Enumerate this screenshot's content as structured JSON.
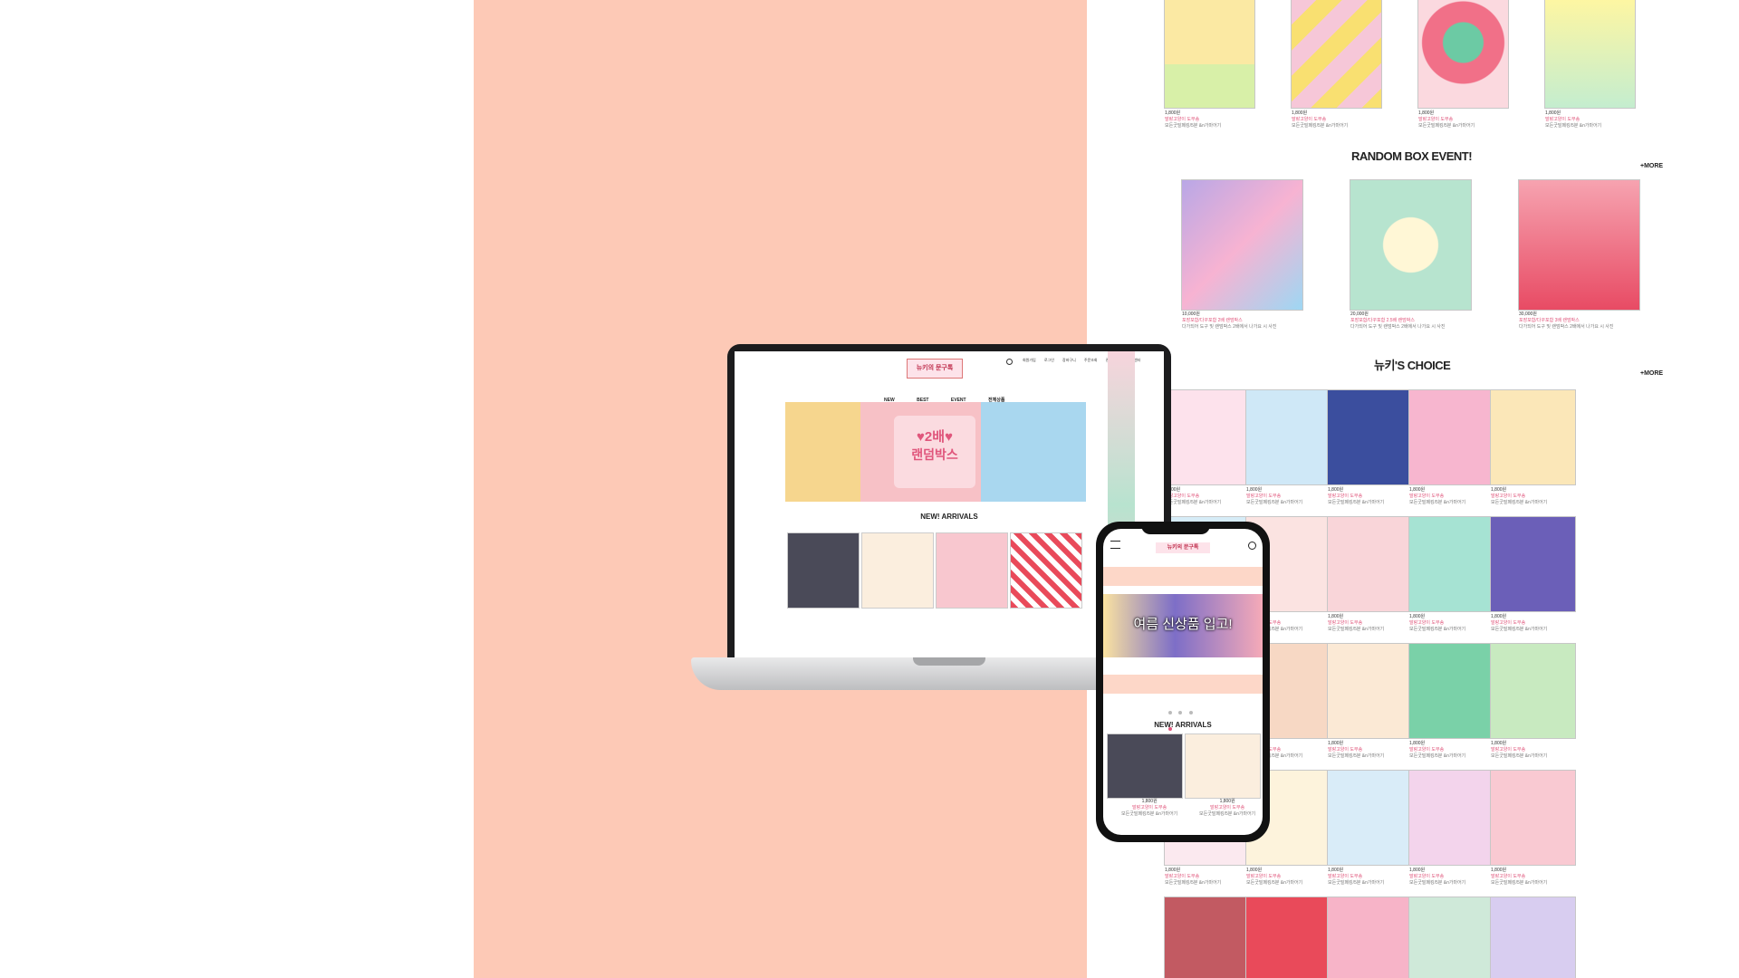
{
  "colors": {
    "accent": "#fdc9b6",
    "pink": "#e0567c"
  },
  "shop": {
    "top_row": [
      {
        "price": "1,800원",
        "name": "말랑고양이 도무송",
        "desc": "모든굿밀페킹/5분 &n가마어기"
      },
      {
        "price": "1,800원",
        "name": "말랑고양이 도무송",
        "desc": "모든굿밀페킹/5분 &n가마어기"
      },
      {
        "price": "1,800원",
        "name": "말랑고양이 도무송",
        "desc": "모든굿밀페킹/5분 &n가마어기"
      },
      {
        "price": "1,800원",
        "name": "말랑고양이 도무송",
        "desc": "모든굿밀페킹/5분 &n가마어기"
      }
    ],
    "random_title": "RANDOM BOX EVENT!",
    "more_label": "+MORE",
    "random_items": [
      {
        "price": "10,000원",
        "name": "포장포함/다꾸포함 2배 랜덤박스",
        "desc": "다가되어 도구 및 랜덤박스 2배에서 나가요 시 사진"
      },
      {
        "price": "20,000원",
        "name": "포장포함/다꾸포함 2.5배 랜덤박스",
        "desc": "다가되어 도구 및 랜덤박스 2배에서 나가요 시 사진"
      },
      {
        "price": "30,000원",
        "name": "포장포함/다꾸포함 3배 랜덤박스",
        "desc": "다가되어 도구 및 랜덤박스 2배에서 나가요 시 사진"
      }
    ],
    "choice_title": "뉴키'S CHOICE",
    "choice_caption": {
      "price": "1,800원",
      "name": "말랑고양이 도무송",
      "desc": "모든굿밀페킹/5분 &n가마어기"
    }
  },
  "laptop": {
    "logo": "뉴키의 문구톡",
    "nav": [
      "NEW",
      "BEST",
      "EVENT",
      "전체상품"
    ],
    "top_links": [
      "회원가입",
      "로그인",
      "장바구니",
      "주문조회",
      "관심상품",
      "고객센터"
    ],
    "banner_line1": "♥2배♥",
    "banner_line2": "랜덤박스",
    "new_arrivals": "NEW! ARRIVALS"
  },
  "phone": {
    "logo": "뉴키의 문구톡",
    "banner_text": "여름 신상품 입고!",
    "new_arrivals": "NEW! ARRIVALS",
    "items": [
      {
        "price": "1,800원",
        "name": "말랑고양이 도무송",
        "desc": "모든굿밀페킹/5분 &n가마어기"
      },
      {
        "price": "1,800원",
        "name": "말랑고양이 도무송",
        "desc": "모든굿밀페킹/5분 &n가마어기"
      }
    ]
  }
}
